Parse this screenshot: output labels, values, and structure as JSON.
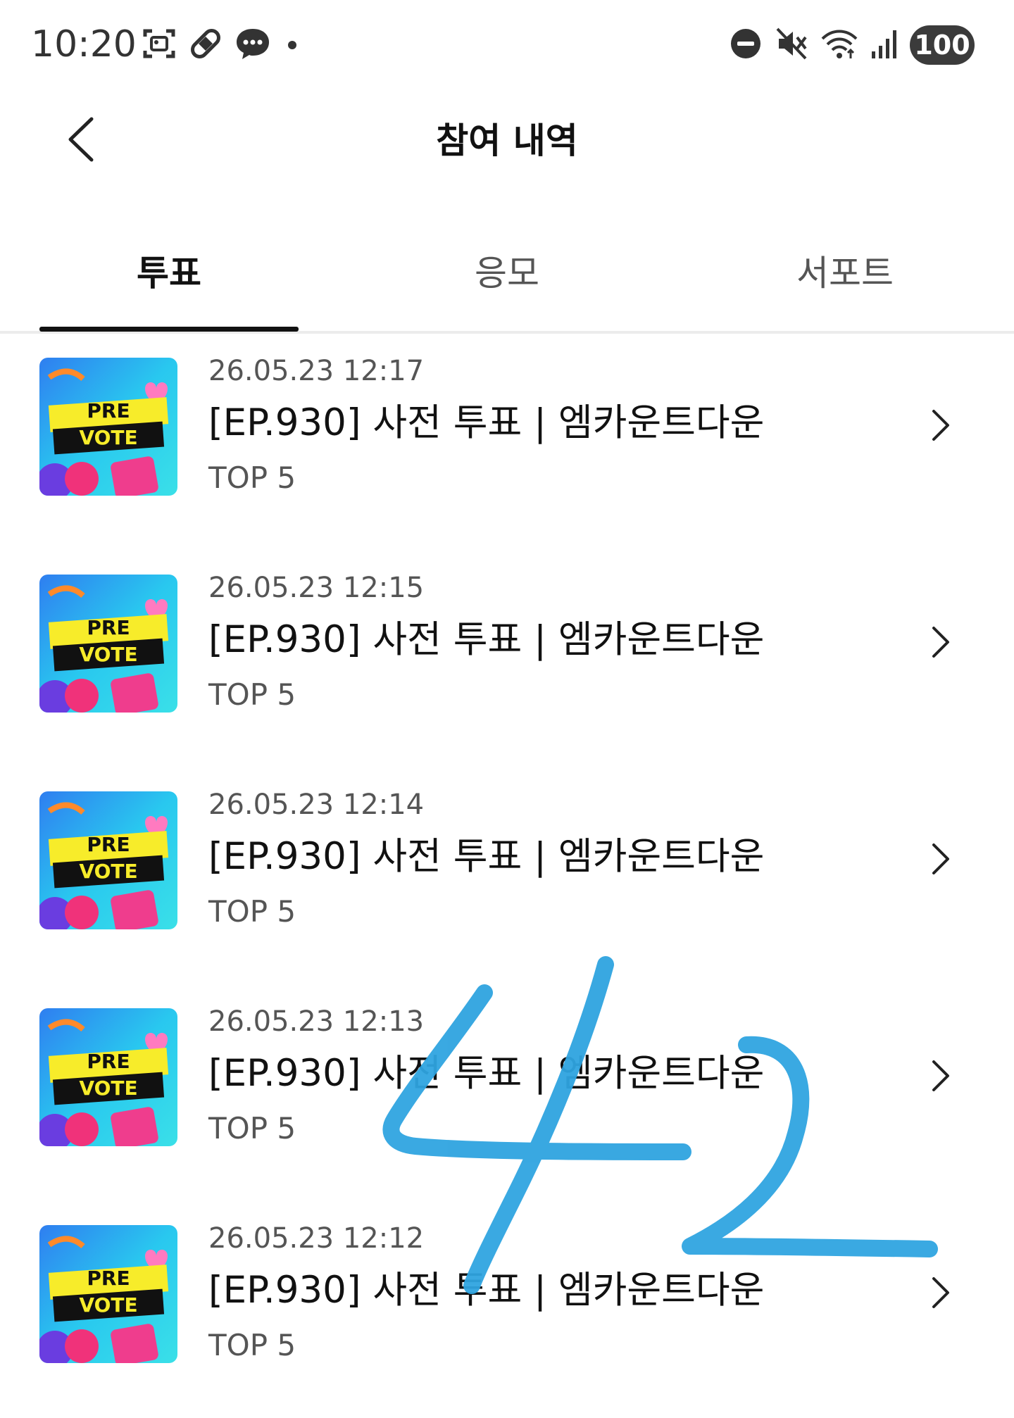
{
  "status_bar": {
    "time": "10:20",
    "battery": "100",
    "left_icons": [
      "screenshot-icon",
      "pill-icon",
      "chat-bubble-icon",
      "dot-icon"
    ],
    "right_icons": [
      "do-not-disturb-icon",
      "mute-icon",
      "wifi-icon",
      "signal-icon"
    ]
  },
  "header": {
    "title": "참여 내역",
    "back_icon": "chevron-left-icon"
  },
  "tabs": [
    {
      "label": "투표",
      "active": true
    },
    {
      "label": "응모",
      "active": false
    },
    {
      "label": "서포트",
      "active": false
    }
  ],
  "items": [
    {
      "date": "26.05.23 12:17",
      "title": "[EP.930] 사전 투표 | 엠카운트다운",
      "subtitle": "TOP 5",
      "thumb_line1": "PRE",
      "thumb_line2": "VOTE"
    },
    {
      "date": "26.05.23 12:15",
      "title": "[EP.930] 사전 투표 | 엠카운트다운",
      "subtitle": "TOP 5",
      "thumb_line1": "PRE",
      "thumb_line2": "VOTE"
    },
    {
      "date": "26.05.23 12:14",
      "title": "[EP.930] 사전 투표 | 엠카운트다운",
      "subtitle": "TOP 5",
      "thumb_line1": "PRE",
      "thumb_line2": "VOTE"
    },
    {
      "date": "26.05.23 12:13",
      "title": "[EP.930] 사전 투표 | 엠카운트다운",
      "subtitle": "TOP 5",
      "thumb_line1": "PRE",
      "thumb_line2": "VOTE"
    },
    {
      "date": "26.05.23 12:12",
      "title": "[EP.930] 사전 투표 | 엠카운트다운",
      "subtitle": "TOP 5",
      "thumb_line1": "PRE",
      "thumb_line2": "VOTE"
    }
  ],
  "handwritten_annotation": "42",
  "colors": {
    "annotation": "#2fa4e0",
    "tab_active": "#111111",
    "thumb_bg": "#2ec8f0",
    "thumb_label_bg": "#f7ec2a"
  }
}
